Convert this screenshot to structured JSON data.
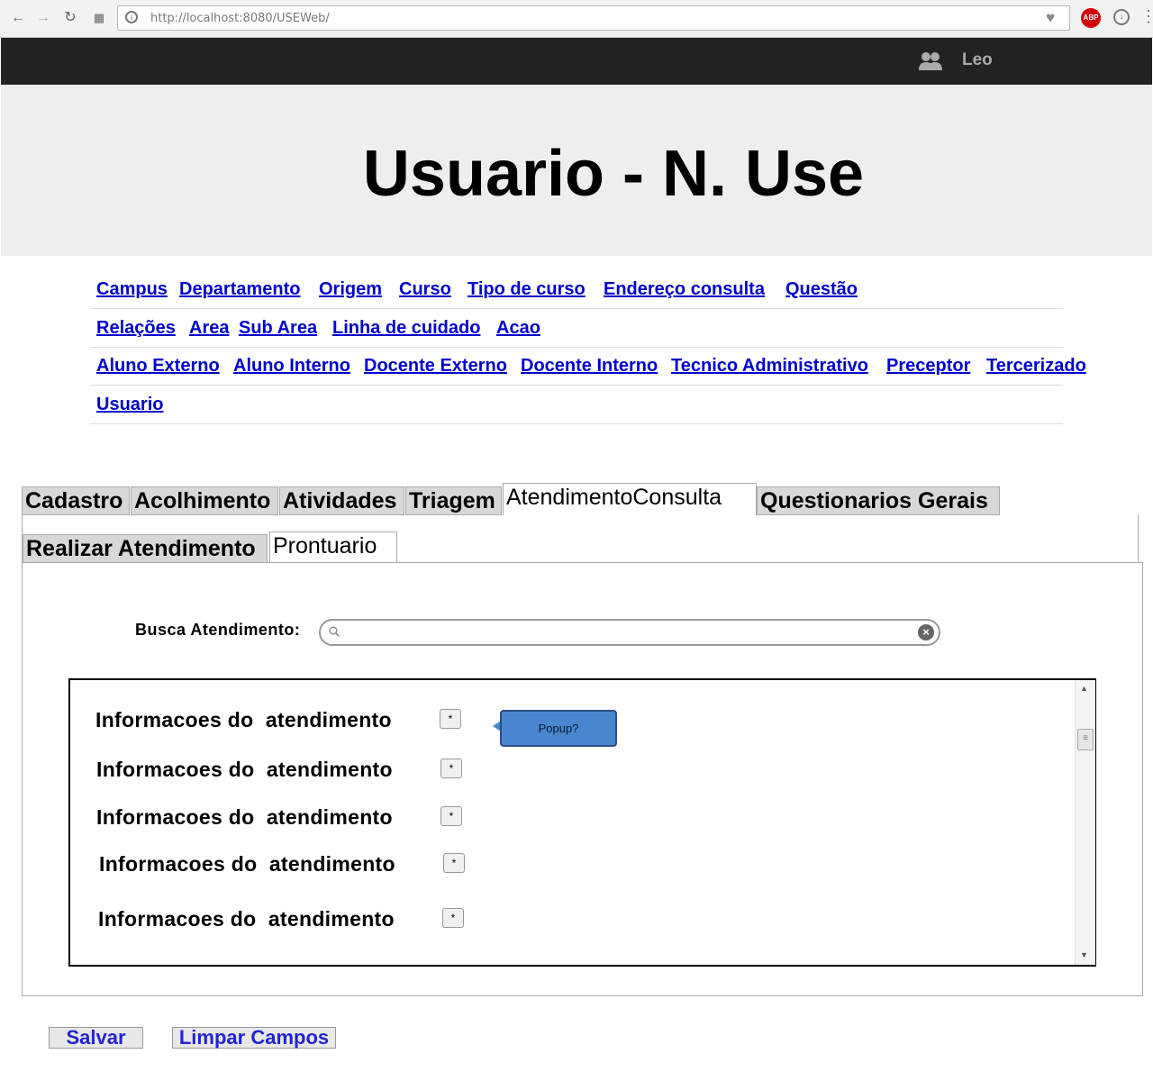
{
  "browser": {
    "url": "http://localhost:8080/USEWeb/",
    "abp_label": "ABP"
  },
  "topbar": {
    "user_name": "Leo"
  },
  "header": {
    "title": "Usuario - N. Use"
  },
  "nav": {
    "rows": [
      [
        "Campus",
        "Departamento",
        "Origem",
        "Curso",
        "Tipo de curso",
        "Endereço consulta",
        "Questão"
      ],
      [
        "Relações",
        "Area",
        "Sub Area",
        "Linha de cuidado",
        "Acao"
      ],
      [
        "Aluno Externo",
        "Aluno Interno",
        "Docente Externo",
        "Docente Interno",
        "Tecnico Administrativo",
        "Preceptor",
        "Tercerizado"
      ],
      [
        "Usuario"
      ]
    ]
  },
  "tabs": [
    "Cadastro",
    "Acolhimento",
    "Atividades",
    "Triagem",
    "AtendimentoConsulta",
    "Questionarios Gerais"
  ],
  "subtabs": [
    "Realizar Atendimento",
    "Prontuario"
  ],
  "search": {
    "label": "Busca Atendimento:",
    "value": "",
    "placeholder": ""
  },
  "list": {
    "items": [
      "Informacoes do  atendimento",
      "Informacoes do  atendimento",
      "Informacoes do  atendimento",
      "Informacoes do  atendimento",
      "Informacoes do  atendimento"
    ],
    "item_button_label": "*",
    "popup_text": "Popup?"
  },
  "actions": {
    "save_label": "Salvar",
    "clear_label": "Limpar Campos"
  },
  "colors": {
    "link": "#0000cc",
    "topbar": "#222222",
    "header_bg": "#eeeeee",
    "popup": "#4a86d0",
    "button_text": "#2323d8"
  }
}
